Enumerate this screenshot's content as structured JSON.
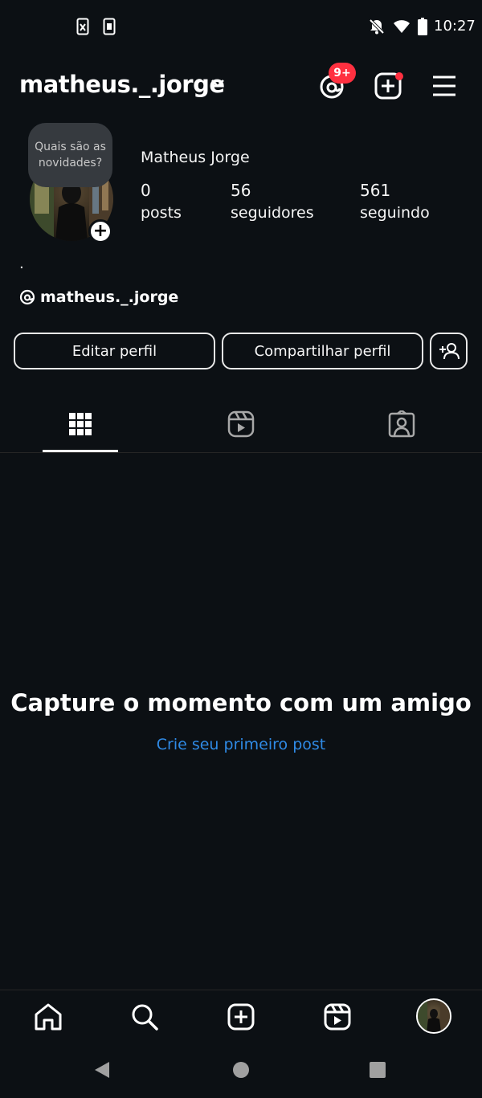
{
  "status_bar": {
    "time": "10:27"
  },
  "header": {
    "username": "matheus._.jorge",
    "threads_badge": "9+"
  },
  "profile": {
    "note": "Quais são as novidades?",
    "full_name": "Matheus Jorge",
    "stats": [
      {
        "value": "0",
        "label": "posts"
      },
      {
        "value": "56",
        "label": "seguidores"
      },
      {
        "value": "561",
        "label": "seguindo"
      }
    ],
    "bio": ".",
    "threads_handle": "matheus._.jorge"
  },
  "actions": {
    "edit": "Editar perfil",
    "share": "Compartilhar perfil"
  },
  "empty_state": {
    "title": "Capture o momento com um amigo",
    "link": "Crie seu primeiro post"
  },
  "colors": {
    "background": "#0c1014",
    "badge": "#ff3040",
    "link": "#2f8ae5"
  }
}
